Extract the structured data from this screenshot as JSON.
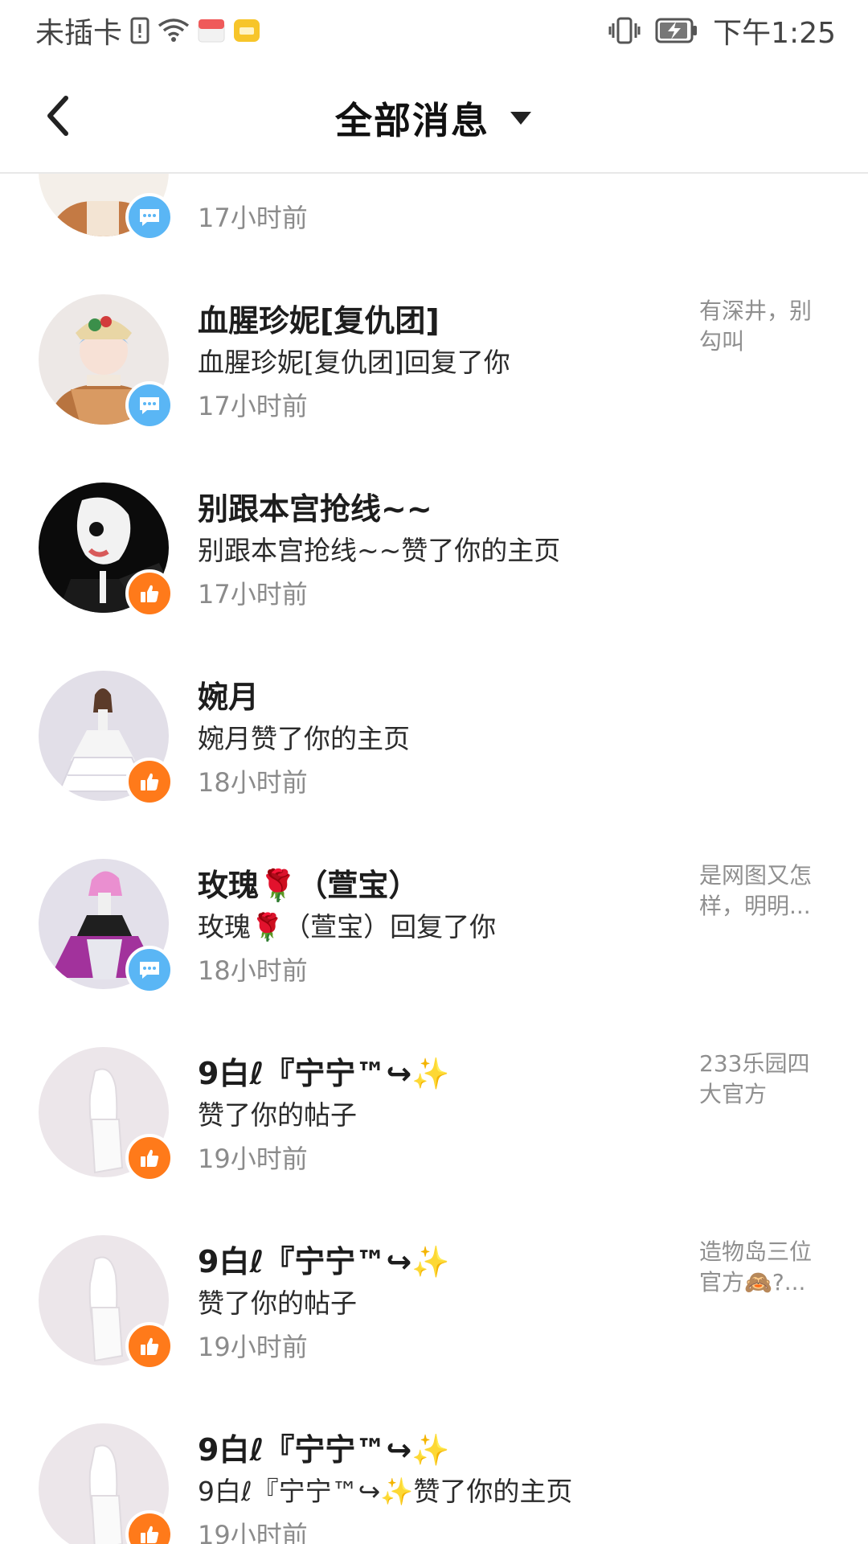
{
  "status_bar": {
    "carrier": "未插卡",
    "time": "下午1:25",
    "icons": [
      "sim-alert-icon",
      "wifi-icon",
      "app-notification-icon",
      "folder-notification-icon",
      "vibrate-icon",
      "battery-charging-icon"
    ]
  },
  "header": {
    "title": "全部消息",
    "back_icon": "chevron-left-icon",
    "dropdown_icon": "caret-down-icon"
  },
  "messages": [
    {
      "name": "",
      "action": "",
      "time": "17小时前",
      "preview": "",
      "badge": "comment",
      "avatar_colors": [
        "#f4efe9",
        "#c47a44"
      ]
    },
    {
      "name": "血腥珍妮[复仇团]",
      "action": "血腥珍妮[复仇团]回复了你",
      "time": "17小时前",
      "preview": "有深井，别勾叫",
      "badge": "comment",
      "avatar_colors": [
        "#ede8e6",
        "#b8743f"
      ]
    },
    {
      "name": "别跟本宫抢线~~",
      "action": "别跟本宫抢线~~赞了你的主页",
      "time": "17小时前",
      "preview": "",
      "badge": "like",
      "avatar_colors": [
        "#0b0b0b",
        "#f2f2f2"
      ]
    },
    {
      "name": "婉月",
      "action": "婉月赞了你的主页",
      "time": "18小时前",
      "preview": "",
      "badge": "like",
      "avatar_colors": [
        "#e2dfe8",
        "#ffffff"
      ]
    },
    {
      "name": "玫瑰🌹（萱宝）",
      "action": "玫瑰🌹（萱宝）回复了你",
      "time": "18小时前",
      "preview": "是网图又怎样，明明...",
      "badge": "comment",
      "avatar_colors": [
        "#e3e0ea",
        "#a2329c"
      ]
    },
    {
      "name": "9白ℓ『宁宁™↪✨",
      "action": "赞了你的帖子",
      "time": "19小时前",
      "preview": "233乐园四大官方",
      "badge": "like",
      "avatar_colors": [
        "#ece6ea",
        "#ffffff"
      ]
    },
    {
      "name": "9白ℓ『宁宁™↪✨",
      "action": "赞了你的帖子",
      "time": "19小时前",
      "preview": "造物岛三位官方🙈?...",
      "badge": "like",
      "avatar_colors": [
        "#ece6ea",
        "#ffffff"
      ]
    },
    {
      "name": "9白ℓ『宁宁™↪✨",
      "action": "9白ℓ『宁宁™↪✨赞了你的主页",
      "time": "19小时前",
      "preview": "",
      "badge": "like",
      "avatar_colors": [
        "#ece6ea",
        "#ffffff"
      ]
    }
  ]
}
